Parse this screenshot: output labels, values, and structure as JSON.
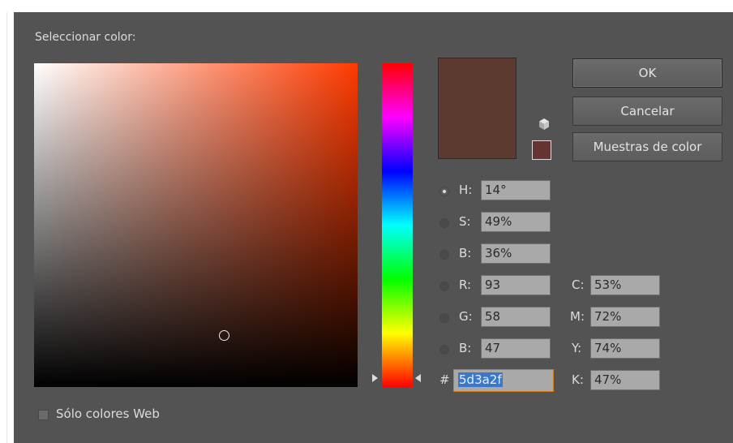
{
  "dialog": {
    "title": "Seleccionar color:",
    "current_color": "#5d3a2f",
    "websafe_color": "#663333"
  },
  "icons": {
    "websafe_warning": "cube-icon"
  },
  "buttons": {
    "ok": "OK",
    "cancel": "Cancelar",
    "swatches": "Muestras de color"
  },
  "hsb": {
    "h_label": "H:",
    "h_value": "14°",
    "s_label": "S:",
    "s_value": "49%",
    "b_label": "B:",
    "b_value": "36%",
    "selected": "H"
  },
  "rgb": {
    "r_label": "R:",
    "r_value": "93",
    "g_label": "G:",
    "g_value": "58",
    "b_label": "B:",
    "b_value": "47"
  },
  "cmyk": {
    "c_label": "C:",
    "c_value": "53%",
    "m_label": "M:",
    "m_value": "72%",
    "y_label": "Y:",
    "y_value": "74%",
    "k_label": "K:",
    "k_value": "47%"
  },
  "hex": {
    "label": "#",
    "value": "5d3a2f"
  },
  "web_only": {
    "label": "Sólo colores Web",
    "checked": false
  }
}
